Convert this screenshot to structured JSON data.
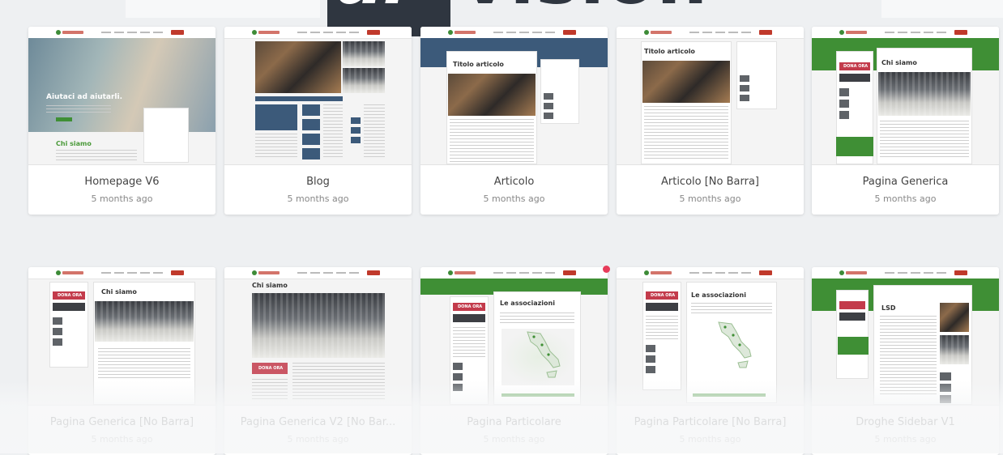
{
  "logo": {
    "box_text": "ui",
    "rest_text": "vision"
  },
  "cards": [
    {
      "title": "Homepage V6",
      "date": "5 months ago",
      "hero_text": "Aiutaci ad aiutarli.",
      "section_text": "Chi siamo"
    },
    {
      "title": "Blog",
      "date": "5 months ago"
    },
    {
      "title": "Articolo",
      "date": "5 months ago",
      "heading_text": "Titolo articolo"
    },
    {
      "title": "Articolo [No Barra]",
      "date": "5 months ago",
      "heading_text": "Titolo articolo"
    },
    {
      "title": "Pagina Generica",
      "date": "5 months ago",
      "heading_text": "Chi siamo",
      "donate_text": "DONA ORA"
    },
    {
      "title": "Pagina Generica [No Barra]",
      "date": "5 months ago",
      "heading_text": "Chi siamo",
      "donate_text": "DONA ORA"
    },
    {
      "title": "Pagina Generica V2 [No Bar...",
      "date": "5 months ago",
      "heading_text": "Chi siamo",
      "donate_text": "DONA ORA"
    },
    {
      "title": "Pagina Particolare",
      "date": "5 months ago",
      "heading_text": "Le associazioni",
      "donate_text": "DONA ORA"
    },
    {
      "title": "Pagina Particolare [No Barra]",
      "date": "5 months ago",
      "heading_text": "Le associazioni",
      "donate_text": "DONA ORA"
    },
    {
      "title": "Droghe Sidebar V1",
      "date": "5 months ago",
      "heading_text": "LSD"
    }
  ],
  "colors": {
    "brand_red": "#c33b4b",
    "brand_green": "#3f8f35",
    "notification_dot": "#e73c5a"
  }
}
